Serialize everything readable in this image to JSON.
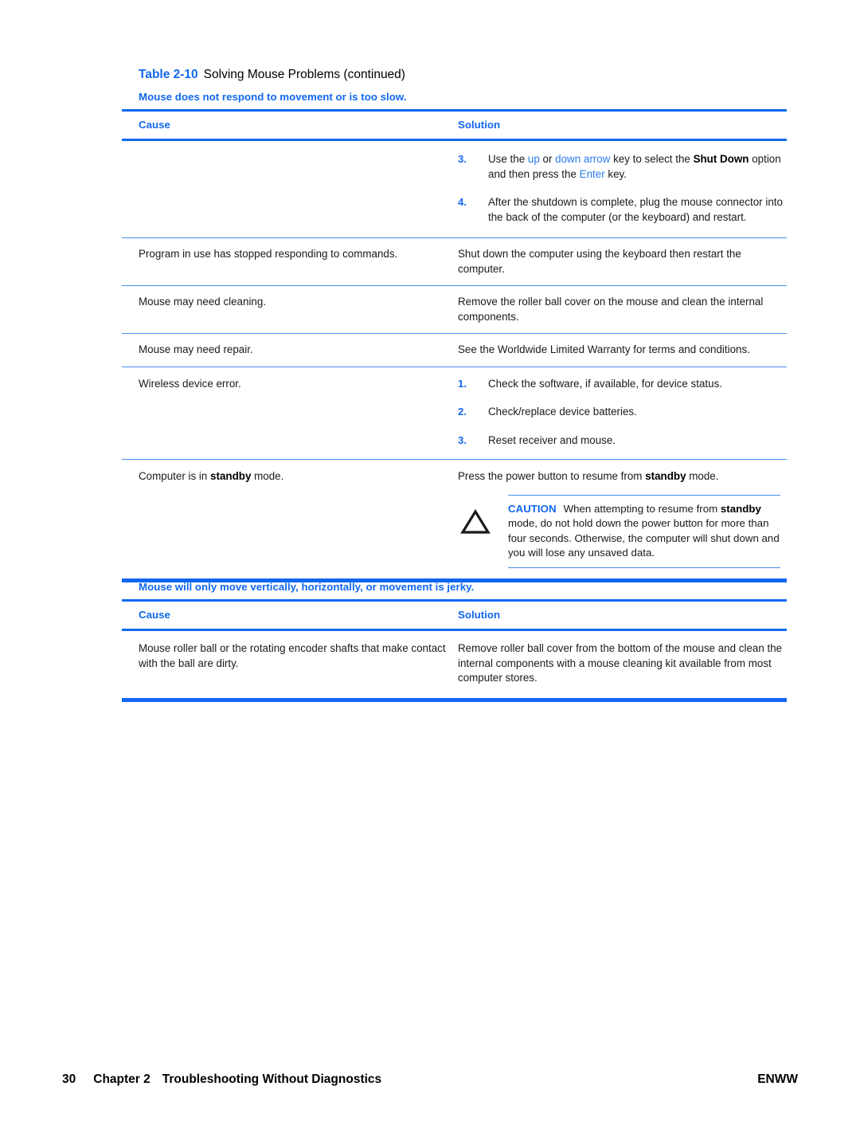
{
  "caption": {
    "number": "Table 2-10",
    "title": "Solving Mouse Problems (continued)"
  },
  "table1": {
    "title": "Mouse does not respond to movement or is too slow.",
    "headers": {
      "cause": "Cause",
      "solution": "Solution"
    },
    "rows": [
      {
        "cause": "",
        "steps": [
          {
            "num": "3.",
            "pre": "Use the ",
            "kw1": "up",
            "mid1": " or ",
            "kw2": "down arrow",
            "mid2": " key to select the ",
            "bold1": "Shut Down",
            "mid3": " option and then press the ",
            "kw3": "Enter",
            "post": " key."
          },
          {
            "num": "4.",
            "text": "After the shutdown is complete, plug the mouse connector into the back of the computer (or the keyboard) and restart."
          }
        ]
      },
      {
        "cause": "Program in use has stopped responding to commands.",
        "solution": "Shut down the computer using the keyboard then restart the computer."
      },
      {
        "cause": "Mouse may need cleaning.",
        "solution": "Remove the roller ball cover on the mouse and clean the internal components."
      },
      {
        "cause": "Mouse may need repair.",
        "solution": "See the Worldwide Limited Warranty for terms and conditions."
      },
      {
        "cause": "Wireless device error.",
        "steps": [
          {
            "num": "1.",
            "text": "Check the software, if available, for device status."
          },
          {
            "num": "2.",
            "text": "Check/replace device batteries."
          },
          {
            "num": "3.",
            "text": "Reset receiver and mouse."
          }
        ]
      },
      {
        "cause_pre": "Computer is in ",
        "cause_bold": "standby",
        "cause_post": " mode.",
        "solution_pre": "Press the power button to resume from ",
        "solution_bold": "standby",
        "solution_post": " mode.",
        "caution": {
          "icon": "warning-triangle-icon",
          "label": "CAUTION",
          "text_pre": "When attempting to resume from ",
          "text_bold": "standby",
          "text_post": " mode, do not hold down the power button for more than four seconds. Otherwise, the computer will shut down and you will lose any unsaved data."
        }
      }
    ]
  },
  "table2": {
    "title": "Mouse will only move vertically, horizontally, or movement is jerky.",
    "headers": {
      "cause": "Cause",
      "solution": "Solution"
    },
    "rows": [
      {
        "cause": "Mouse roller ball or the rotating encoder shafts that make contact with the ball are dirty.",
        "solution": "Remove roller ball cover from the bottom of the mouse and clean the internal components with a mouse cleaning kit available from most computer stores."
      }
    ]
  },
  "footer": {
    "page_number": "30",
    "chapter": "Chapter 2",
    "chapter_title": "Troubleshooting Without Diagnostics",
    "right": "ENWW"
  },
  "colors": {
    "accent_blue": "#1268ef",
    "link_blue": "#2a7cf0",
    "rule_light": "#4a8cf0"
  }
}
